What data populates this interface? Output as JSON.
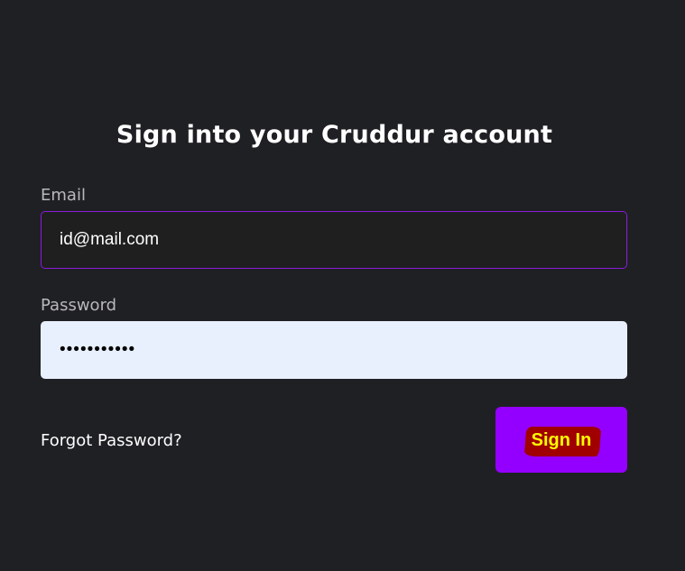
{
  "form": {
    "title": "Sign into your Cruddur account",
    "email": {
      "label": "Email",
      "value": "id@mail.com"
    },
    "password": {
      "label": "Password",
      "value": "•••••••••••"
    },
    "forgot_password_label": "Forgot Password?",
    "sign_in_label": "Sign In"
  },
  "colors": {
    "background": "#1f2024",
    "accent": "#9400ff",
    "focus_border": "#8b1ad9",
    "button_text": "#ffff00",
    "button_highlight": "#a00000",
    "password_fill": "#e8f0fe"
  }
}
